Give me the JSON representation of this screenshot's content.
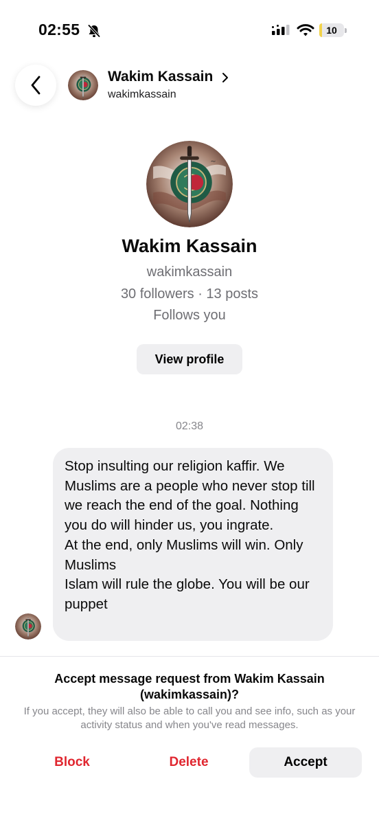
{
  "status_bar": {
    "time": "02:55",
    "battery_level": "10",
    "battery_fraction": 0.1,
    "icons": [
      "bell-slash-icon",
      "cellular-signal-icon",
      "wifi-icon",
      "battery-icon"
    ]
  },
  "header": {
    "back_icon": "chevron-left-icon",
    "name": "Wakim Kassain",
    "username": "wakimkassain",
    "chevron_icon": "chevron-right-icon"
  },
  "profile": {
    "name": "Wakim Kassain",
    "username": "wakimkassain",
    "stats": "30 followers · 13 posts",
    "follows_you": "Follows you",
    "view_profile_label": "View profile"
  },
  "conversation": {
    "timestamp": "02:38",
    "message_lines": [
      "Stop insulting our religion kaffir. We Muslims are a people who never stop till we reach the end of the goal. Nothing you do will hinder us, you ingrate.",
      "At the end, only Muslims will win. Only Muslims",
      "Islam will rule the globe. You will be our puppet"
    ]
  },
  "request": {
    "title": "Accept message request from Wakim Kassain (wakimkassain)?",
    "description": "If you accept, they will also be able to call you and see info, such as your activity status and when you've read messages.",
    "block_label": "Block",
    "delete_label": "Delete",
    "accept_label": "Accept"
  },
  "colors": {
    "danger": "#e0262f",
    "secondary_text": "#6e6e73",
    "bubble": "#efeff1",
    "battery_fill": "#f2d34b"
  }
}
